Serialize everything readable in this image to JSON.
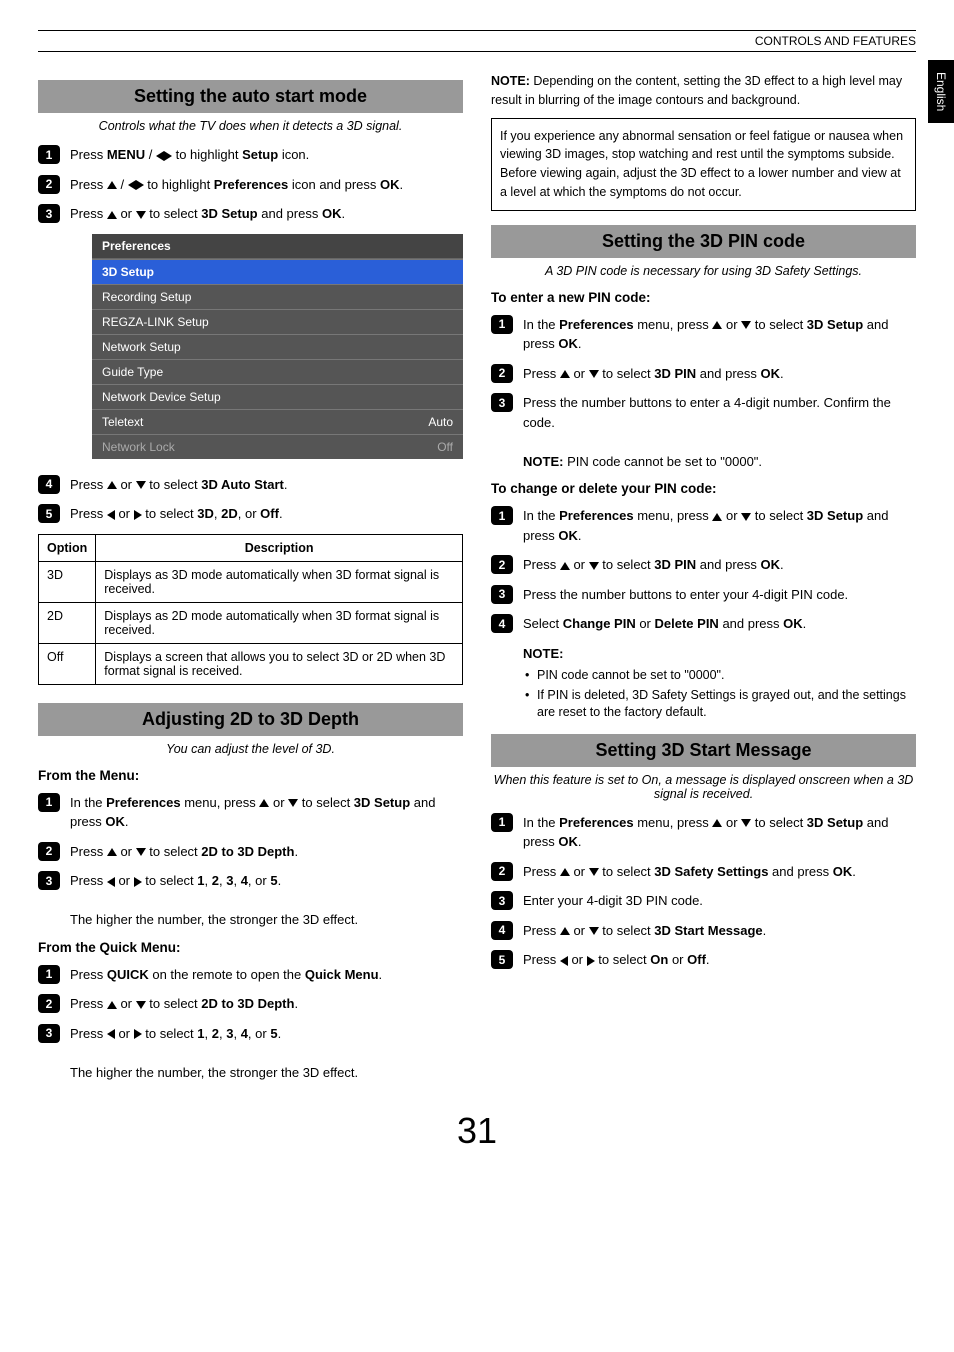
{
  "header_text": "CONTROLS AND FEATURES",
  "side_tab": "English",
  "page_number": "31",
  "left": {
    "sec1": {
      "title": "Setting the auto start mode",
      "sub": "Controls what the TV does when it detects a 3D signal.",
      "s1_a": "Press ",
      "s1_b": "MENU",
      "s1_c": " / ",
      "s1_d": " to highlight ",
      "s1_e": "Setup",
      "s1_f": " icon.",
      "s2_a": "Press ",
      "s2_b": " / ",
      "s2_c": " to highlight ",
      "s2_d": "Preferences",
      "s2_e": " icon and press ",
      "s2_f": "OK",
      "s2_g": ".",
      "s3_a": "Press ",
      "s3_b": " or ",
      "s3_c": " to select ",
      "s3_d": "3D Setup",
      "s3_e": " and press ",
      "s3_f": "OK",
      "s3_g": ".",
      "menu": {
        "header": "Preferences",
        "items": [
          {
            "label": "3D Setup",
            "val": "",
            "sel": true
          },
          {
            "label": "Recording Setup",
            "val": ""
          },
          {
            "label": "REGZA-LINK Setup",
            "val": ""
          },
          {
            "label": "Network Setup",
            "val": ""
          },
          {
            "label": "Guide Type",
            "val": ""
          },
          {
            "label": "Network Device Setup",
            "val": ""
          },
          {
            "label": "Teletext",
            "val": "Auto"
          },
          {
            "label": "Network Lock",
            "val": "Off",
            "dim": true
          }
        ]
      },
      "s4_a": "Press ",
      "s4_b": " or ",
      "s4_c": " to select ",
      "s4_d": "3D Auto Start",
      "s4_e": ".",
      "s5_a": "Press ",
      "s5_b": " or ",
      "s5_c": " to select ",
      "s5_d": "3D",
      "s5_e": ", ",
      "s5_f": "2D",
      "s5_g": ", or ",
      "s5_h": "Off",
      "s5_i": ".",
      "table": {
        "h1": "Option",
        "h2": "Description",
        "r1a": "3D",
        "r1b": "Displays as 3D mode automatically when 3D format signal is received.",
        "r2a": "2D",
        "r2b": "Displays as 2D mode automatically when 3D format signal is received.",
        "r3a": "Off",
        "r3b": "Displays a screen that allows you to select 3D or 2D when 3D format signal is received."
      }
    },
    "sec2": {
      "title": "Adjusting 2D to 3D Depth",
      "sub": "You can adjust the level of 3D.",
      "h1": "From the Menu:",
      "m1_a": "In the ",
      "m1_b": "Preferences",
      "m1_c": " menu, press ",
      "m1_d": " or ",
      "m1_e": " to select ",
      "m1_f": "3D Setup",
      "m1_g": " and press ",
      "m1_h": "OK",
      "m1_i": ".",
      "m2_a": "Press ",
      "m2_b": " or ",
      "m2_c": " to select ",
      "m2_d": "2D to 3D Depth",
      "m2_e": ".",
      "m3_a": "Press ",
      "m3_b": " or ",
      "m3_c": " to select ",
      "m3_d": "1",
      "m3_e": ", ",
      "m3_f": "2",
      "m3_g": ", ",
      "m3_h": "3",
      "m3_i": ", ",
      "m3_j": "4",
      "m3_k": ", or ",
      "m3_l": "5",
      "m3_m": ".",
      "m3_tail": "The higher the number, the stronger the 3D effect.",
      "h2": "From the Quick Menu:",
      "q1_a": "Press ",
      "q1_b": "QUICK",
      "q1_c": " on the remote to open the ",
      "q1_d": "Quick Menu",
      "q1_e": ".",
      "q2_a": "Press ",
      "q2_b": " or ",
      "q2_c": " to select ",
      "q2_d": "2D to 3D Depth",
      "q2_e": ".",
      "q3_tail": "The higher the number, the stronger the 3D effect."
    }
  },
  "right": {
    "note1_a": "NOTE:",
    "note1_b": " Depending on the content, setting the 3D effect to a high level may result in blurring of the image contours and background.",
    "box": "If you experience any abnormal sensation or feel fatigue or nausea when viewing 3D images, stop watching and rest until the symptoms subside. Before viewing again, adjust the 3D effect to a lower number and view at a level at which the symptoms do not occur.",
    "pin": {
      "title": "Setting the 3D PIN code",
      "sub": "A 3D PIN code is necessary for using 3D Safety Settings.",
      "h1": "To enter a new PIN code:",
      "e1_a": "In the ",
      "e1_b": "Preferences",
      "e1_c": " menu, press ",
      "e1_d": " or ",
      "e1_e": " to select ",
      "e1_f": "3D Setup",
      "e1_g": " and press ",
      "e1_h": "OK",
      "e1_i": ".",
      "e2_a": "Press ",
      "e2_b": " or ",
      "e2_c": " to select ",
      "e2_d": "3D PIN",
      "e2_e": " and press ",
      "e2_f": "OK",
      "e2_g": ".",
      "e3": "Press the number buttons to enter a 4-digit number. Confirm the code.",
      "e3_note_a": "NOTE:",
      "e3_note_b": " PIN code cannot be set to \"0000\".",
      "h2": "To change or delete your PIN code:",
      "c3": "Press the number buttons to enter your 4-digit PIN code.",
      "c4_a": "Select ",
      "c4_b": "Change PIN",
      "c4_c": " or ",
      "c4_d": "Delete PIN",
      "c4_e": " and press ",
      "c4_f": "OK",
      "c4_g": ".",
      "c4_note": "NOTE:",
      "c4_li1": "PIN code cannot be set to \"0000\".",
      "c4_li2": "If PIN is deleted, 3D Safety Settings is grayed out, and the settings are reset to the factory default."
    },
    "start": {
      "title": "Setting 3D Start Message",
      "sub": "When this feature is set to On, a message is displayed onscreen when a 3D signal is received.",
      "s2_a": "Press ",
      "s2_b": " or ",
      "s2_c": " to select ",
      "s2_d": "3D Safety Settings",
      "s2_e": " and press ",
      "s2_f": "OK",
      "s2_g": ".",
      "s3": "Enter your 4-digit 3D PIN code.",
      "s4_a": "Press ",
      "s4_b": " or ",
      "s4_c": " to select ",
      "s4_d": "3D Start Message",
      "s4_e": ".",
      "s5_a": "Press ",
      "s5_b": " or ",
      "s5_c": " to select ",
      "s5_d": "On",
      "s5_e": " or ",
      "s5_f": "Off",
      "s5_g": "."
    }
  }
}
